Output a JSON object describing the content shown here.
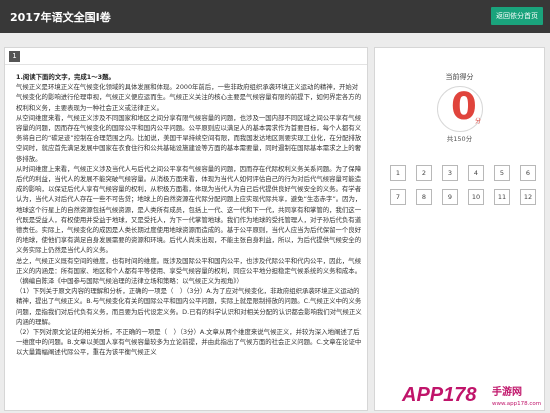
{
  "header": {
    "title": "2017年语文全国Ⅰ卷",
    "back_label": "返回依分首页"
  },
  "question": {
    "number": "1",
    "heading": "1.阅读下面的文字，完成1～3题。",
    "paragraphs": [
      "气候正义是环境正义在气候变化领域的具体发展和体现。2000年前后，一些非政府组织承袭环境正义运动的精神，开始对气候变化的影响进行伦理审视，气候正义便应运而生。气候正义关注的核心主要是气候容量有限的前提下，如何界定各方的权利和义务，主要表现为一种社会正义或法律正义。",
      "从空间维度来看，气候正义涉及不同国家和地区之间分享有限气候容量的问题，也涉及一国内部不同区域之间公平享有气候容量的问题，因而存在气候变化的国际公平和国内公平问题。公平原则应以满足人的基本需求作为首要目标，每个人都有义务将自己的“碳足迹”控制在合理范围之内。比如说，美国干旱持续空间有限，而我国发达地区则要实现工业化，在分配排放空间时，就应首先满足发展中国家在衣食住行和公共基础设施建设等方面的基本需要量，同时遏制在国际基本需求之上的奢侈排放。",
      "从时间维度上来看，气候正义涉及当代人与后代之间公平享有气候容量的问题，因而存在代际权利义务关系问题。为了保障后代的利益，当代人的发展不能突破气候容量。从消极方面来看，体现为当代人如何评估自己的行为对后代气候容量可能造成的影响，以保证后代人享有气候容量的权利，从积极方面看，体现为当代人为自己后代提供良好气候安全的义务。有学者认为，当代人对后代人存在一些不可告贷；地球上的自然资源在代际分配问题上应实现代际共享，避免“生态赤字”。因为，地球这个行星上的自然资源包括气候资源，是人类所有成员，包括上一代、这一代和下一代，共同享有和掌管的，我们这一代既是受益人，有权使用并受益于地球，又是受托人，为下一代掌管地球。我们作为地球的受托管理人，对子孙后代负有道德责任。实际上，气候变化的成因是人类长期过度使用地球资源而造成的。基于公平原则，当代人应当为后代保留一个良好的地球，使他们享有满足自身发展需要的资源和环境。后代人尚未出现，不能主张自身利益，所以，为后代提供气候安全的义务实际上仍然是当代人的义务。",
      "总之，气候正义既有空间的维度，也有时间的维度。既涉及国际公平和国内公平，也涉及代际公平和代内公平，因此，气候正义的内涵是：所有国家、地区和个人都有平等使用、享受气候容量的权利，同应公平地分担稳定气候系统的义务和成本。",
      "（摘编自陈泽《中国参与国际气候治理的法律立场和策略：以气候正义为视角》）",
      "（1）下列关于原文内容的理解和分析，正确的一项是（　）（3分）A.为了应对气候变化，非政府组织承袭环境正义运动的精神，提出了气候正义。B.与气候变化有关的国际公平和国内公平问题，实际上就是限制排放的问题。C.气候正义中的义务问题，是指我们对后代负有义务，而且要为后代设定义务。D.已有的科学认识和对相关分配的认识都会影响我们对气候正义内涵的理解。",
      "（2）下列对原文论证的相关分析，不正确的一项是（　）（3分）A.文章从两个维度来说气候正义，并较为深入地阐述了后一维度中的问题。B.文章以美国人享有气候容量较多为立论前提，并由此指出了气候方面的社会正义问题。C.文章在论证中以大量篇幅阐述代际公平，重在为该平衡气候正义"
    ]
  },
  "score": {
    "label": "当前得分",
    "value": "0",
    "unit": "分",
    "total": "共150分"
  },
  "question_nav": [
    "1",
    "2",
    "3",
    "4",
    "5",
    "6",
    "7",
    "8",
    "9",
    "10",
    "11",
    "12"
  ],
  "watermark": {
    "brand": "APP178",
    "suffix": "手游网",
    "url": "www.app178.com"
  },
  "colors": {
    "topbar": "#383838",
    "accent": "#1aa37c",
    "score": "#e0443c",
    "watermark": "#c0146a"
  }
}
